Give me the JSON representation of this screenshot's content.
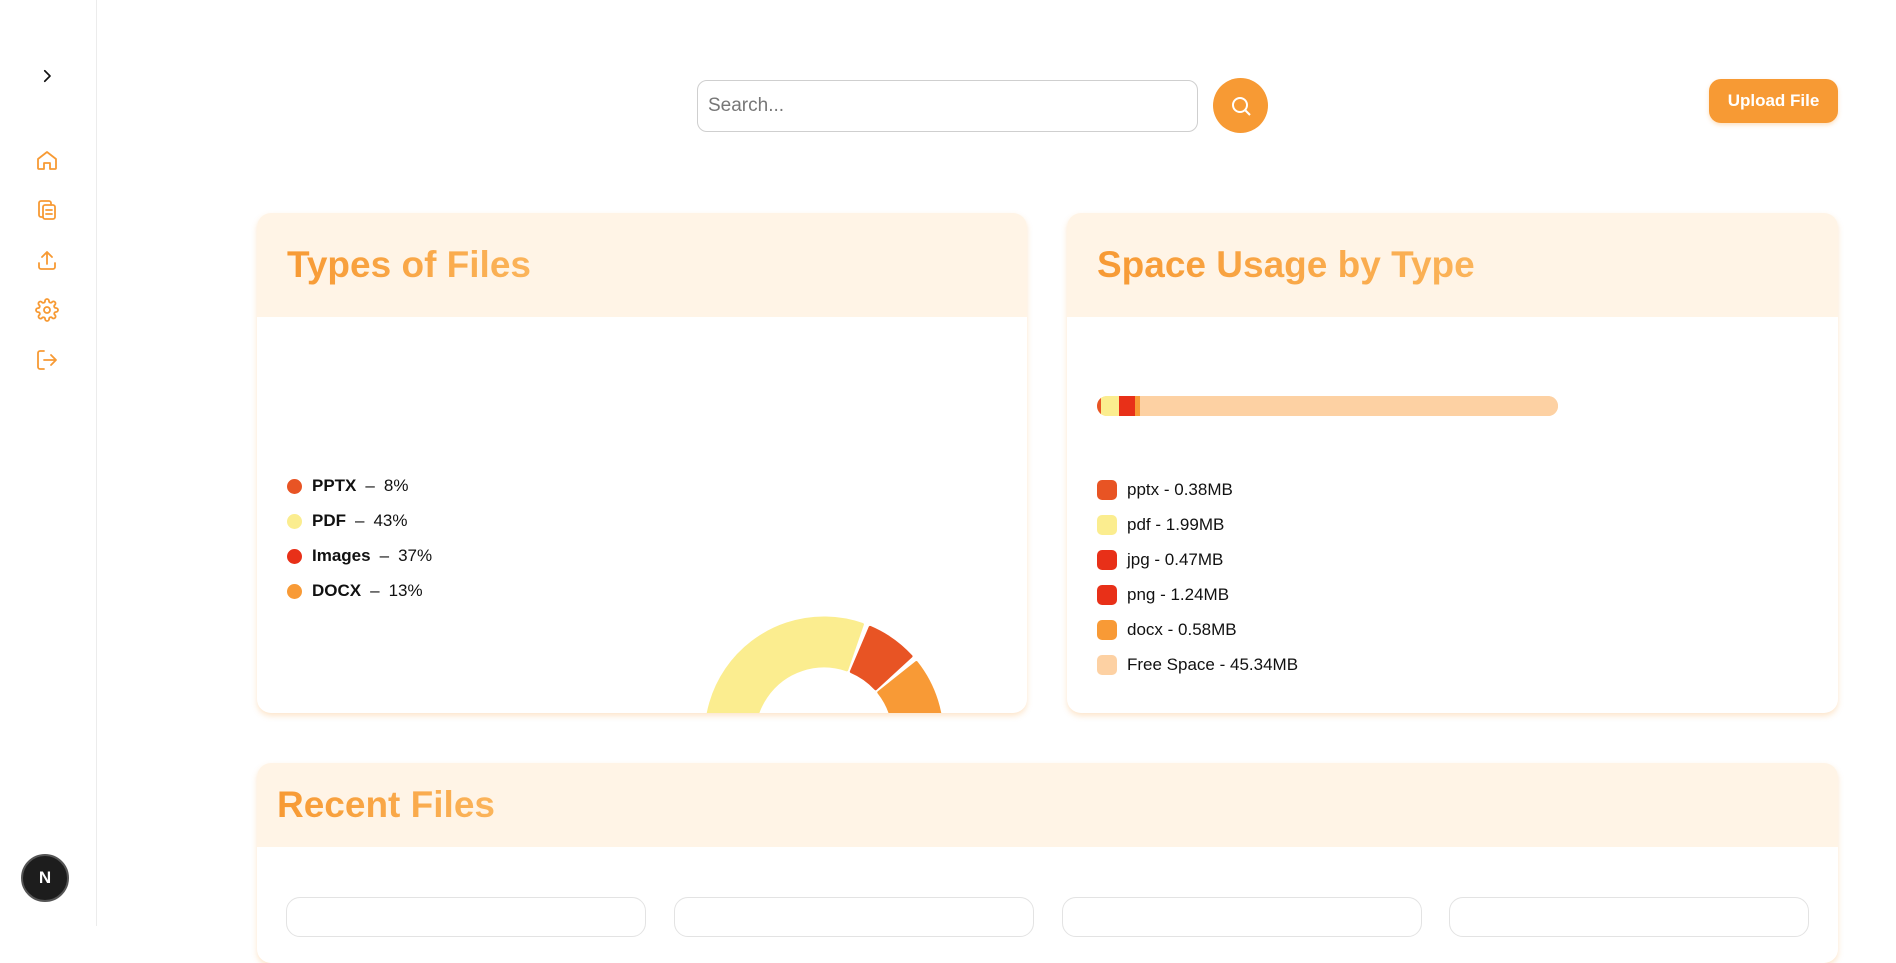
{
  "search": {
    "placeholder": "Search..."
  },
  "upload_label": "Upload File",
  "sidebar": {
    "items": [
      {
        "icon": "home-icon"
      },
      {
        "icon": "files-icon"
      },
      {
        "icon": "upload-icon"
      },
      {
        "icon": "settings-icon"
      },
      {
        "icon": "logout-icon"
      }
    ],
    "badge": "N"
  },
  "types_card": {
    "title": "Types of Files",
    "legend": [
      {
        "name": "PPTX",
        "sep": "–",
        "pct": "8%",
        "color": "#e85424"
      },
      {
        "name": "PDF",
        "sep": "–",
        "pct": "43%",
        "color": "#fbed8f"
      },
      {
        "name": "Images",
        "sep": "–",
        "pct": "37%",
        "color": "#e83018"
      },
      {
        "name": "DOCX",
        "sep": "–",
        "pct": "13%",
        "color": "#f89a36"
      }
    ]
  },
  "space_card": {
    "title": "Space Usage by Type",
    "legend": [
      {
        "label": "pptx - 0.38MB",
        "color": "#e85424"
      },
      {
        "label": "pdf - 1.99MB",
        "color": "#fbed8f"
      },
      {
        "label": "jpg - 0.47MB",
        "color": "#e83018"
      },
      {
        "label": "png - 1.24MB",
        "color": "#e83018"
      },
      {
        "label": "docx - 0.58MB",
        "color": "#f89a36"
      },
      {
        "label": "Free Space - 45.34MB",
        "color": "#fdd1a3"
      }
    ]
  },
  "recent_card": {
    "title": "Recent Files"
  },
  "chart_data": [
    {
      "type": "pie",
      "categories": [
        "PPTX",
        "PDF",
        "Images",
        "DOCX"
      ],
      "values": [
        8,
        43,
        37,
        13
      ],
      "colors": [
        "#e85424",
        "#fbed8f",
        "#e83018",
        "#f89a36"
      ],
      "title": "Types of Files"
    },
    {
      "type": "bar",
      "categories": [
        "pptx",
        "pdf",
        "jpg",
        "png",
        "docx",
        "Free Space"
      ],
      "values": [
        0.38,
        1.99,
        0.47,
        1.24,
        0.58,
        45.34
      ],
      "colors": [
        "#e85424",
        "#fbed8f",
        "#e83018",
        "#e83018",
        "#f89a36",
        "#fdd1a3"
      ],
      "title": "Space Usage by Type",
      "ylabel": "MB"
    }
  ]
}
